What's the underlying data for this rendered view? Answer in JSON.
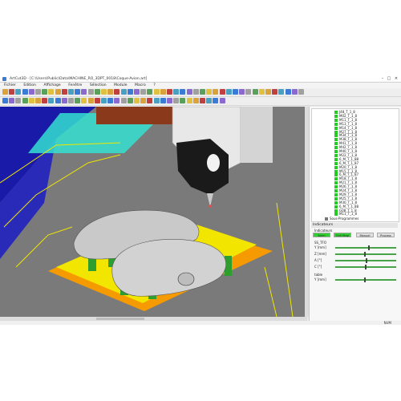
{
  "window": {
    "title": "ArtCut3D - [C:\\Users\\Public\\Data\\MACHINE_RO_3DPT_0018\\Coque-Avion.art]"
  },
  "menu": [
    "Fichier",
    "Edition",
    "Affichage",
    "Fenêtre",
    "Sélection",
    "Module",
    "Macro",
    "?"
  ],
  "tree": {
    "items": [
      "J48_T_1_8",
      "M02_T_1_8",
      "M11_T_1_8",
      "M13_T_1_8",
      "M14_T_1_8",
      "M27_T_1_8",
      "M34_T_1_8",
      "M38_T_1_8",
      "M41_T_1_8",
      "M42_T_1_8",
      "M40_T_1_8",
      "M22_T_1_8",
      "6_M_T_1_88",
      "6_M_T_1_87",
      "M20_T_1_8",
      "M15_T_1_8",
      "6_M_T_1_87",
      "M18_T_1_8",
      "M21_T_1_8",
      "M26_T_1_8",
      "M24_T_1_8",
      "M29_T_1_8",
      "M25_T_1_8",
      "M30_T_1_8",
      "6_M_T_1_88",
      "G08_T_1_8",
      "M11_T_1_8"
    ],
    "footer": "Sous-Programmes"
  },
  "indicators": {
    "title": "Indicateurs",
    "section": "Indicateurs",
    "buttons": [
      "Anim",
      "Coll Stop",
      "Manuel",
      "Process"
    ],
    "group1": {
      "label": "SS_TFO",
      "axes": [
        {
          "name": "Y [mm]",
          "value": 0.55
        },
        {
          "name": "Z [mm]",
          "value": 0.48
        },
        {
          "name": "A [°]",
          "value": 0.52
        },
        {
          "name": "C [°]",
          "value": 0.5
        }
      ]
    },
    "group2": {
      "label": "table",
      "axes": [
        {
          "name": "Y [mm]",
          "value": 0.49
        }
      ]
    }
  },
  "status": {
    "num": "NUM"
  },
  "colors": {
    "accent_green": "#22cc22",
    "viewport_bg": "#7a7a7a",
    "fixture_yellow": "#f2e600",
    "fixture_orange": "#f59a00"
  }
}
